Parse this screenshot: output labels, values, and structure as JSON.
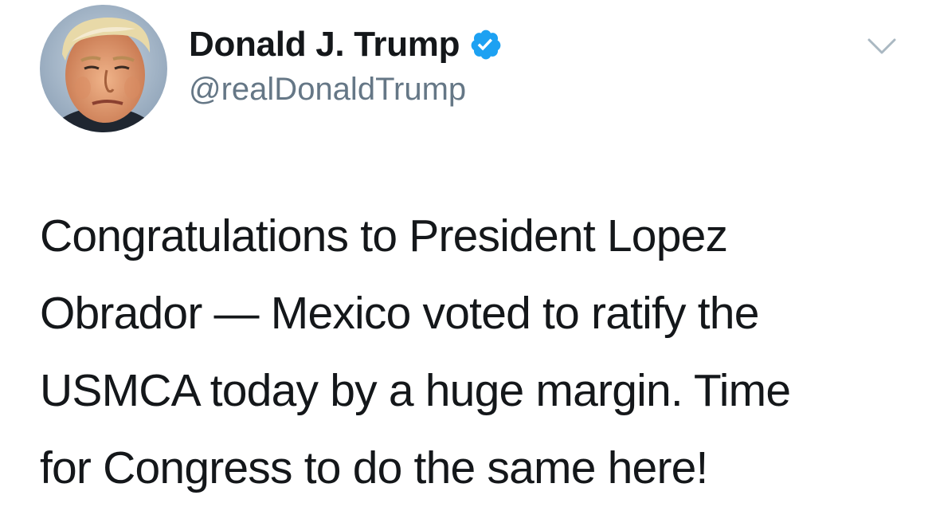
{
  "author": {
    "display_name": "Donald J. Trump",
    "handle": "@realDonaldTrump",
    "verified": true,
    "avatar_icon": "profile-photo"
  },
  "tweet": {
    "lines": [
      "Congratulations to President Lopez",
      "Obrador — Mexico voted to ratify the",
      "USMCA today by a huge margin. Time",
      "for Congress to do the same here!"
    ]
  },
  "colors": {
    "verified_blue": "#1da1f2",
    "handle_gray": "#657786",
    "text_dark": "#14171a",
    "caret_gray": "#aab8c2"
  },
  "icons": {
    "verified": "verified-badge-icon",
    "menu": "chevron-down-icon"
  }
}
